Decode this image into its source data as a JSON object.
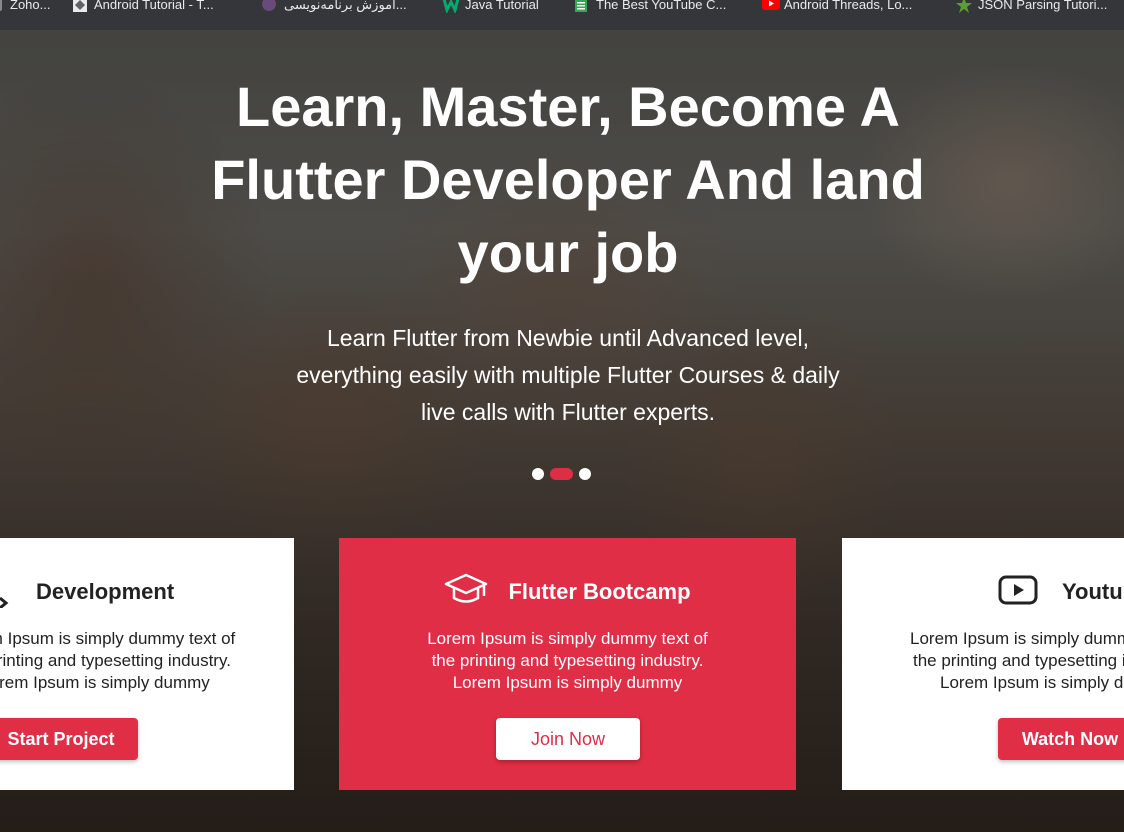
{
  "bookmarks": [
    {
      "label": "Zoho...",
      "icon": "zoho-icon",
      "color": "#888888"
    },
    {
      "label": "Android Tutorial - T...",
      "icon": "android-tutorial-icon",
      "color": "#9aa0a6"
    },
    {
      "label": "آموزش برنامه‌نویسی...",
      "icon": "persian-site-icon",
      "color": "#6a4a7a"
    },
    {
      "label": "Java Tutorial",
      "icon": "w3schools-icon",
      "color": "#04aa6d"
    },
    {
      "label": "The Best YouTube C...",
      "icon": "document-icon",
      "color": "#34a853"
    },
    {
      "label": "Android Threads, Lo...",
      "icon": "youtube-icon",
      "color": "#ff0000"
    },
    {
      "label": "JSON Parsing Tutori...",
      "icon": "star-icon",
      "color": "#5c9e31"
    }
  ],
  "hero": {
    "title_lines": [
      "Learn, Master, Become A",
      "Flutter Developer And land",
      "your job"
    ],
    "subtitle_lines": [
      "Learn Flutter from Newbie until Advanced level,",
      "everything easily with multiple Flutter Courses & daily",
      "live calls with Flutter experts."
    ],
    "slides": 3,
    "active_slide": 2
  },
  "cards": {
    "left": {
      "icon": "code-icon",
      "title": "Development",
      "text_lines": [
        "Lorem Ipsum is simply dummy text of",
        "the printing and typesetting industry.",
        "Lorem Ipsum is simply dummy"
      ],
      "button": "Start Project"
    },
    "middle": {
      "icon": "graduation-cap-icon",
      "title": "Flutter Bootcamp",
      "text_lines": [
        "Lorem Ipsum is simply dummy text of",
        "the printing and typesetting industry.",
        "Lorem Ipsum is simply dummy"
      ],
      "button": "Join Now"
    },
    "right": {
      "icon": "youtube-icon",
      "title": "Youtube",
      "text_lines": [
        "Lorem Ipsum is simply dummy text of",
        "the printing and typesetting industry.",
        "Lorem Ipsum is simply dummy"
      ],
      "button": "Watch Now"
    }
  },
  "colors": {
    "accent": "#df2e45",
    "bookmark_bar": "#35363a",
    "text_light": "#ffffff",
    "text_dark": "#222222"
  }
}
